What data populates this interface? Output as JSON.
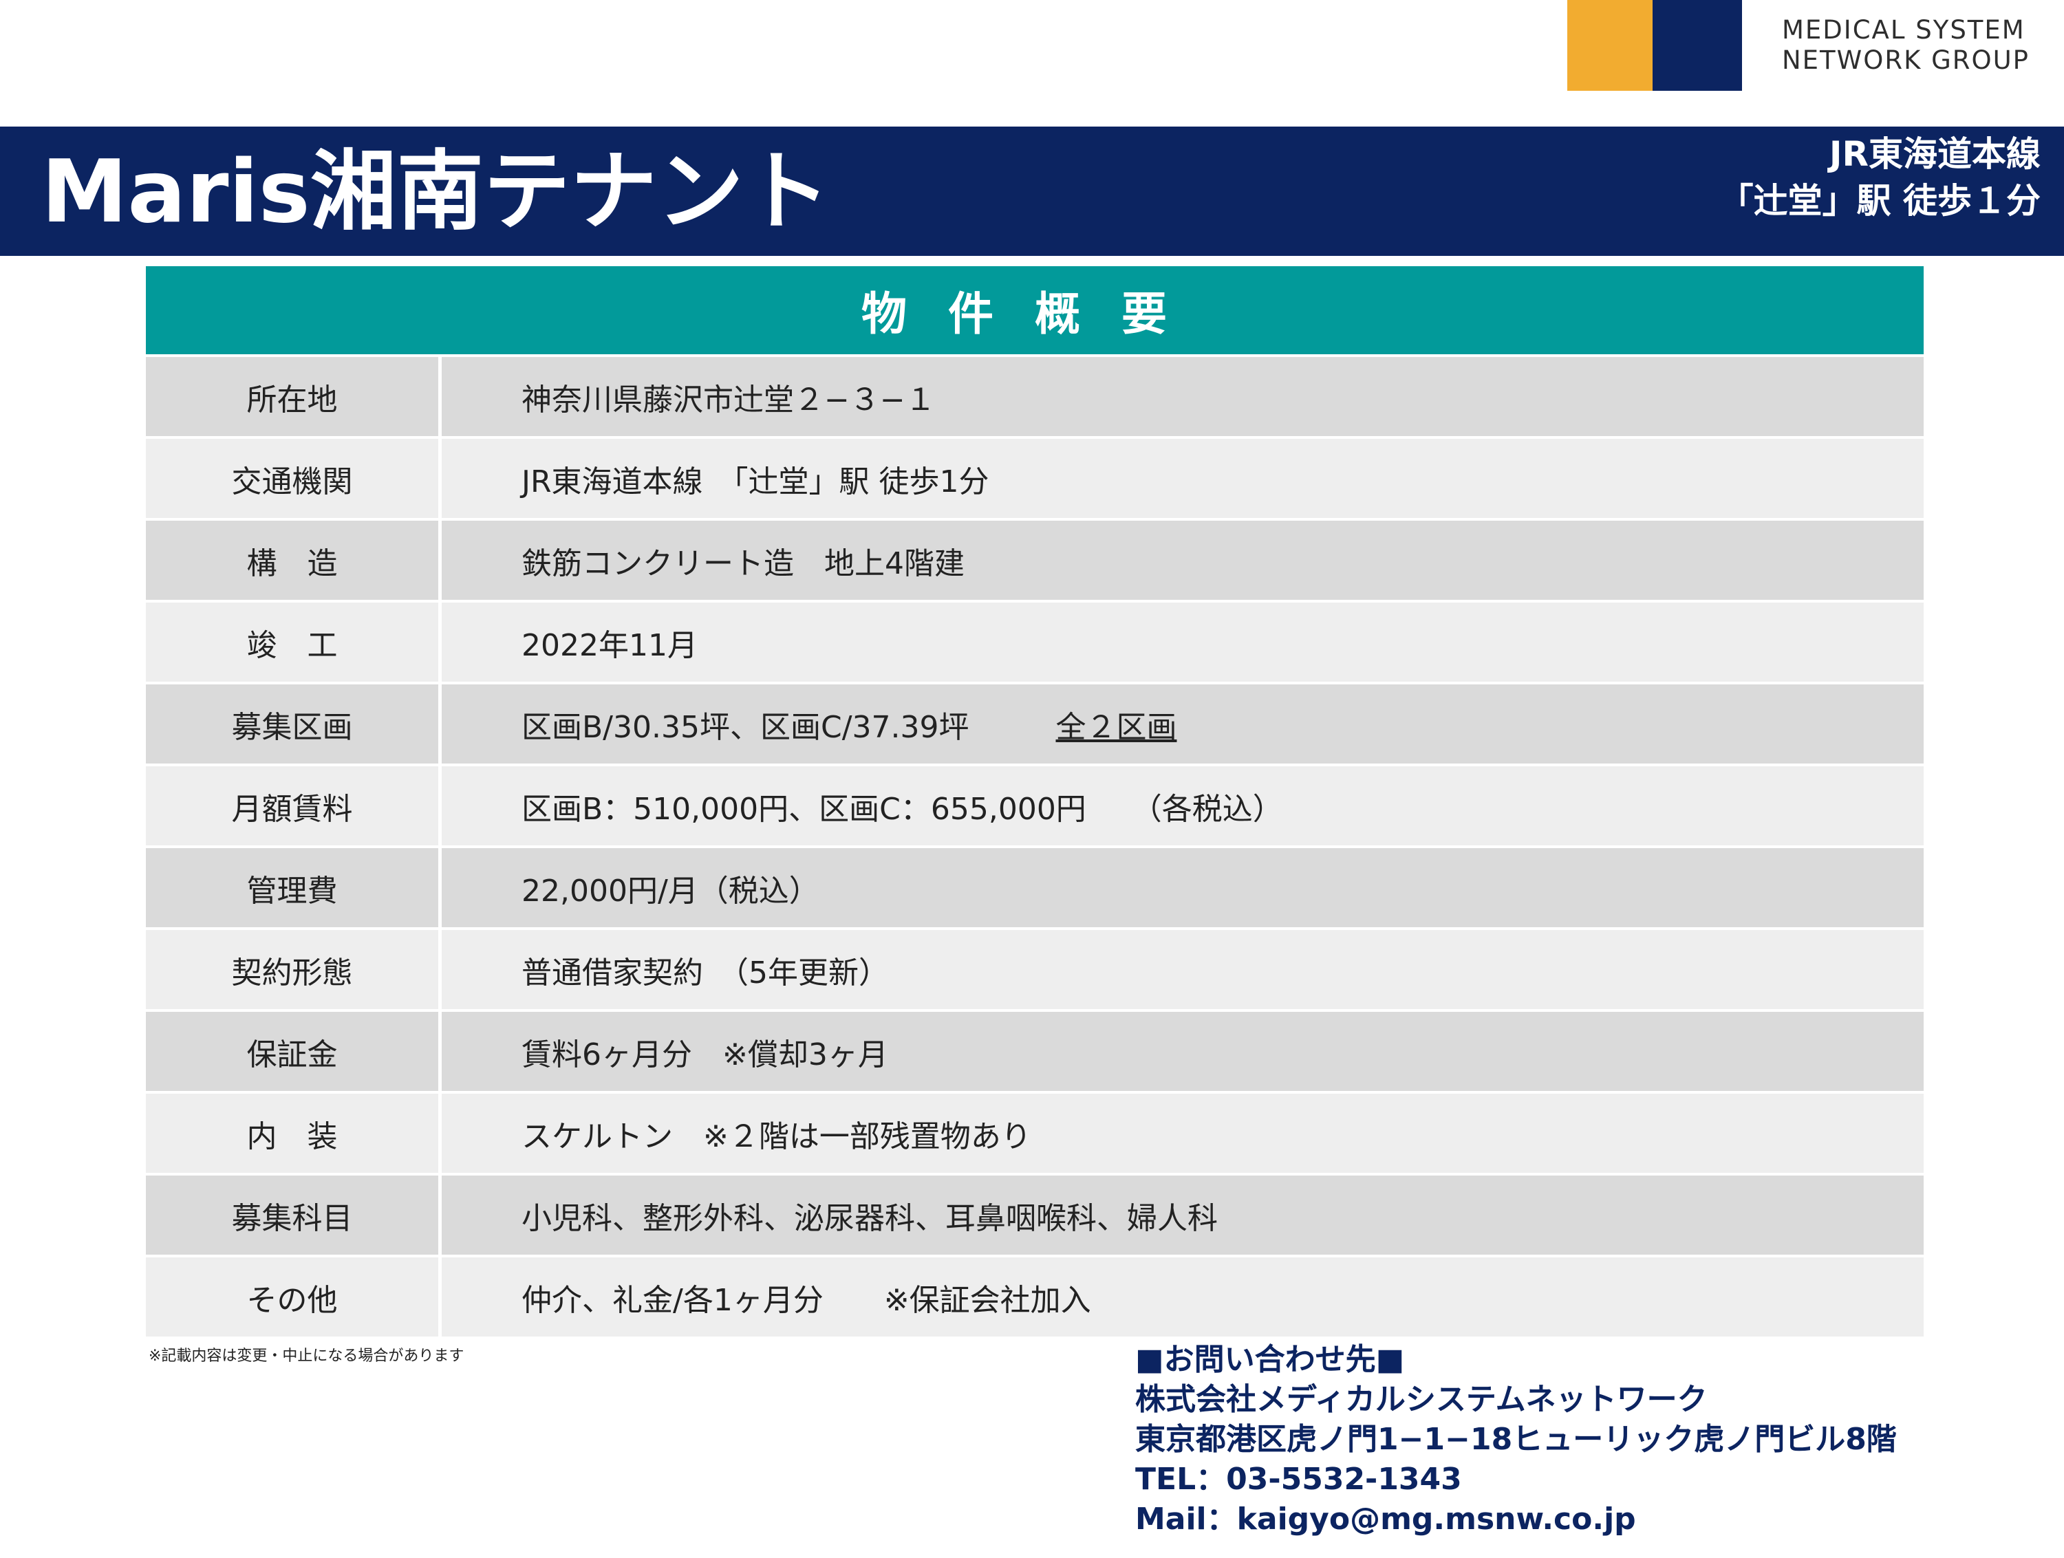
{
  "logo": {
    "line1": "MEDICAL SYSTEM",
    "line2": "NETWORK GROUP",
    "colors": {
      "orange": "#F2AC30",
      "navy": "#0C2461"
    }
  },
  "header": {
    "title": "Maris湘南テナント",
    "station_line1": "JR東海道本線",
    "station_line2": "「辻堂」駅 徒歩１分"
  },
  "table": {
    "heading": "物件概要",
    "rows": [
      {
        "label": "所在地",
        "value": "神奈川県藤沢市辻堂２−３−１"
      },
      {
        "label": "交通機関",
        "value": "JR東海道本線　「辻堂」駅 徒歩1分"
      },
      {
        "label": "構　造",
        "value": "鉄筋コンクリート造　地上4階建"
      },
      {
        "label": "竣　工",
        "value": "2022年11月"
      },
      {
        "label": "募集区画",
        "value": "区画B/30.35坪、区画C/37.39坪",
        "extra": "全２区画"
      },
      {
        "label": "月額賃料",
        "value": "区画B：510,000円、区画C：655,000円　　（各税込）"
      },
      {
        "label": "管理費",
        "value": "22,000円/月（税込）"
      },
      {
        "label": "契約形態",
        "value": "普通借家契約　（5年更新）"
      },
      {
        "label": "保証金",
        "value": "賃料6ヶ月分　※償却3ヶ月"
      },
      {
        "label": "内　装",
        "value": "スケルトン　※２階は一部残置物あり"
      },
      {
        "label": "募集科目",
        "value": "小児科、整形外科、泌尿器科、耳鼻咽喉科、婦人科"
      },
      {
        "label": "その他",
        "value": "仲介、礼金/各1ヶ月分　　※保証会社加入"
      }
    ]
  },
  "note": "※記載内容は変更・中止になる場合があります",
  "contact": {
    "heading": "■お問い合わせ先■",
    "company": "株式会社メディカルシステムネットワーク",
    "address": "東京都港区虎ノ門1−1−18ヒューリック虎ノ門ビル8階",
    "tel": "TEL：03-5532-1343",
    "mail": "Mail：kaigyo@mg.msnw.co.jp"
  },
  "colors": {
    "navy": "#0C2461",
    "teal": "#029A9A",
    "row_dark": "#DADADA",
    "row_light": "#EEEEEE"
  }
}
